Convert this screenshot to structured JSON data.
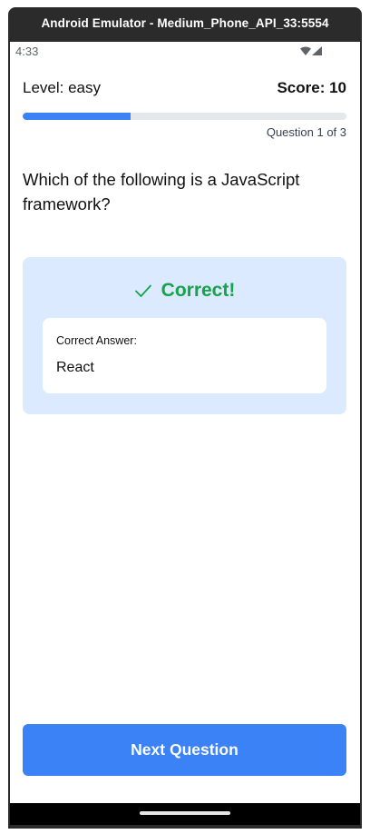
{
  "window": {
    "title": "Android Emulator - Medium_Phone_API_33:5554"
  },
  "status_bar": {
    "time": "4:33",
    "icons": [
      "wifi-icon",
      "signal-icon"
    ]
  },
  "quiz": {
    "level": "Level: easy",
    "score": "Score: 10",
    "progress_fraction": 0.3333,
    "question_counter": "Question 1 of 3",
    "question": "Which of the following is a JavaScript framework?"
  },
  "feedback": {
    "icon": "check-icon",
    "status": "Correct!",
    "correct_answer_label": "Correct Answer:",
    "correct_answer": "React"
  },
  "actions": {
    "next_label": "Next Question"
  },
  "colors": {
    "accent": "#3b82f6",
    "success": "#16a34a",
    "feedback_bg": "#dbeafe",
    "progress_track": "#e5e7eb"
  }
}
